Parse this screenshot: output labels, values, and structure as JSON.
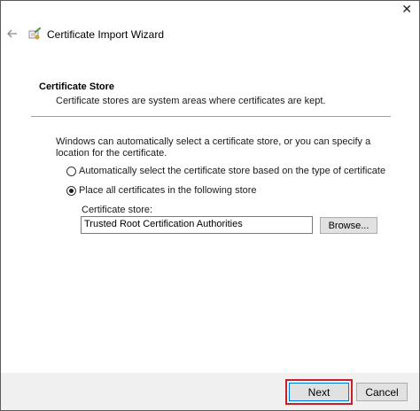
{
  "window": {
    "close_glyph": "✕",
    "title": "Certificate Import Wizard",
    "back_icon": "back-arrow-icon",
    "wizard_icon": "certificate-wizard-icon"
  },
  "section": {
    "title": "Certificate Store",
    "description": "Certificate stores are system areas where certificates are kept."
  },
  "body": {
    "intro": "Windows can automatically select a certificate store, or you can specify a location for the certificate.",
    "options": [
      {
        "label": "Automatically select the certificate store based on the type of certificate",
        "checked": false
      },
      {
        "label": "Place all certificates in the following store",
        "checked": true
      }
    ],
    "store_label": "Certificate store:",
    "store_value": "Trusted Root Certification Authorities",
    "browse_label": "Browse..."
  },
  "footer": {
    "next_label": "Next",
    "cancel_label": "Cancel",
    "highlight_color": "#c8202a"
  }
}
